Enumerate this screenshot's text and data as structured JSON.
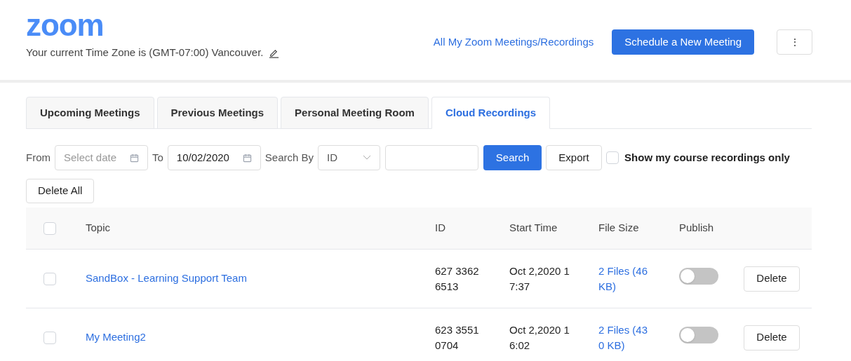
{
  "header": {
    "logo": "zoom",
    "timezone": "Your current Time Zone is (GMT-07:00) Vancouver.",
    "link": "All My Zoom Meetings/Recordings",
    "schedule_button": "Schedule a New Meeting",
    "more_button": "⋮"
  },
  "tabs": [
    {
      "label": "Upcoming Meetings",
      "selected": false
    },
    {
      "label": "Previous Meetings",
      "selected": false
    },
    {
      "label": "Personal Meeting Room",
      "selected": false
    },
    {
      "label": "Cloud Recordings",
      "selected": true
    }
  ],
  "filters": {
    "from_label": "From",
    "from_placeholder": "Select date",
    "to_label": "To",
    "to_value": "10/02/2020",
    "search_by_label": "Search By",
    "search_by_value": "ID",
    "search_button": "Search",
    "export_button": "Export",
    "course_only": {
      "label": "Show my course recordings only",
      "checked": false
    },
    "delete_all_button": "Delete All"
  },
  "table": {
    "columns": [
      "Topic",
      "ID",
      "Start Time",
      "File Size",
      "Publish"
    ],
    "all_checked": false,
    "rows": [
      {
        "checked": false,
        "topic": "SandBox - Learning Support Team",
        "id": "627 3362 6513",
        "start_time": "Oct 2,2020 17:37",
        "file_size": "2 Files (46 KB)",
        "published": false,
        "action": "Delete"
      },
      {
        "checked": false,
        "topic": "My Meeting2",
        "id": "623 3551 0704",
        "start_time": "Oct 2,2020 16:02",
        "file_size": "2 Files (430 KB)",
        "published": false,
        "action": "Delete"
      }
    ]
  }
}
